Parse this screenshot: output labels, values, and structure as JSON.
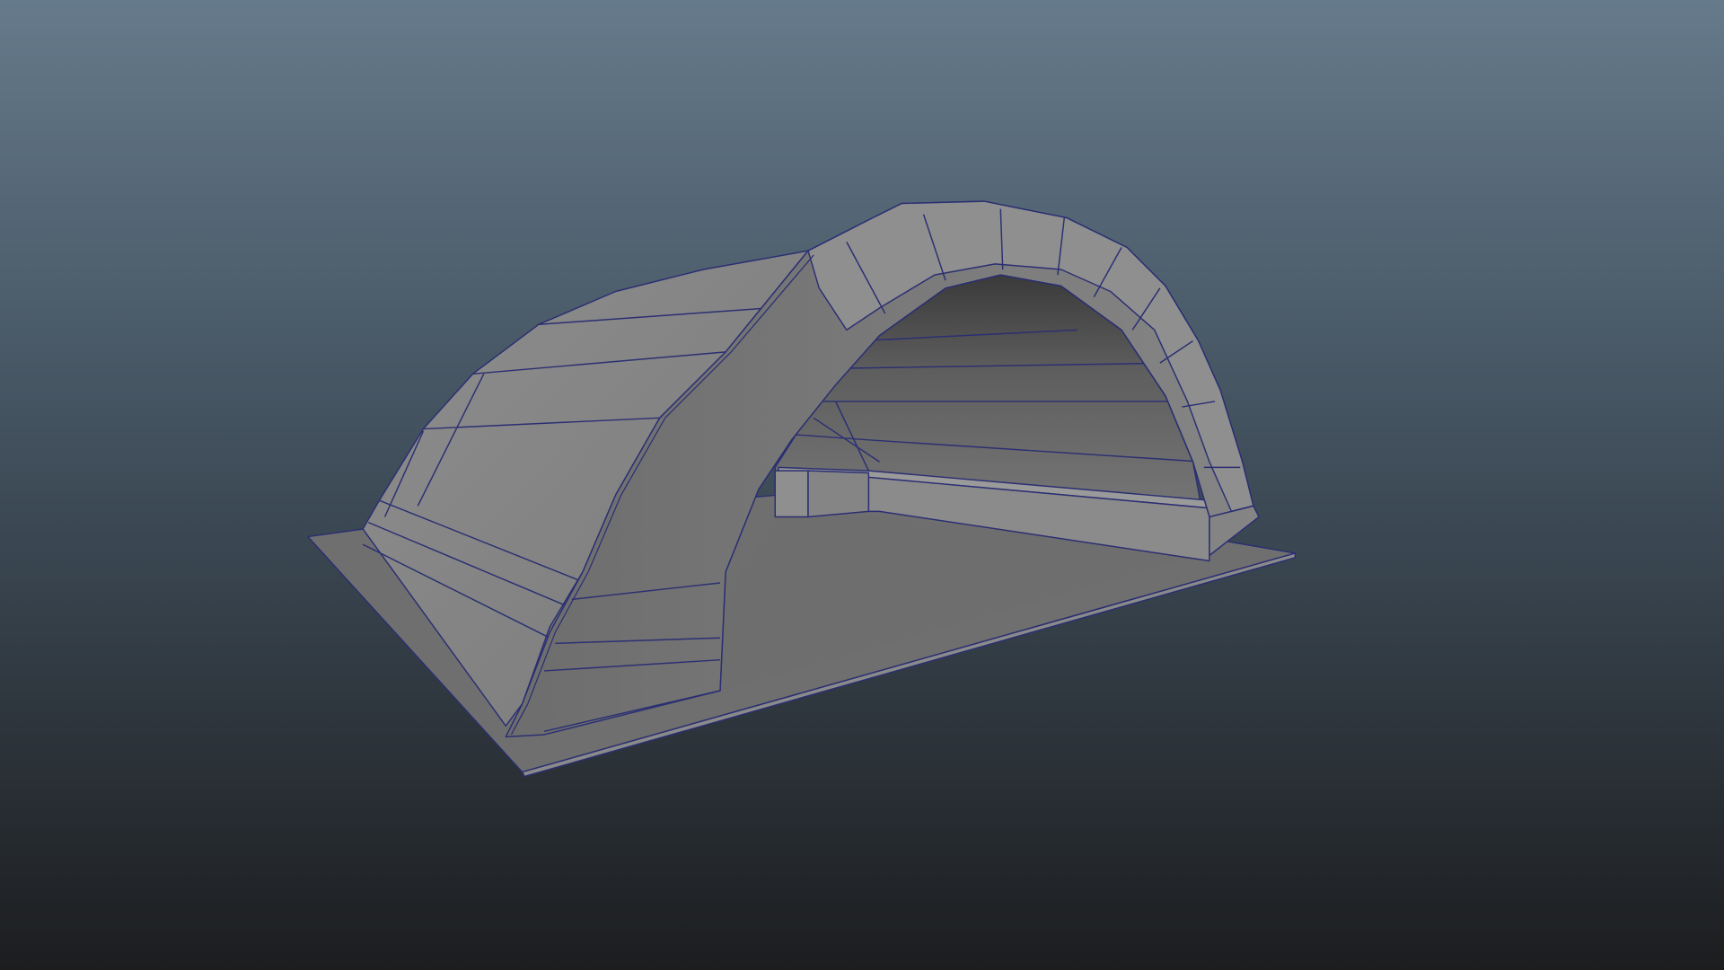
{
  "viewport": {
    "gradient_top": "#657a8b",
    "gradient_bottom": "#1c1d1f",
    "wireframe_color": "#2b2f72",
    "object": "quonset-hangar-mesh"
  }
}
